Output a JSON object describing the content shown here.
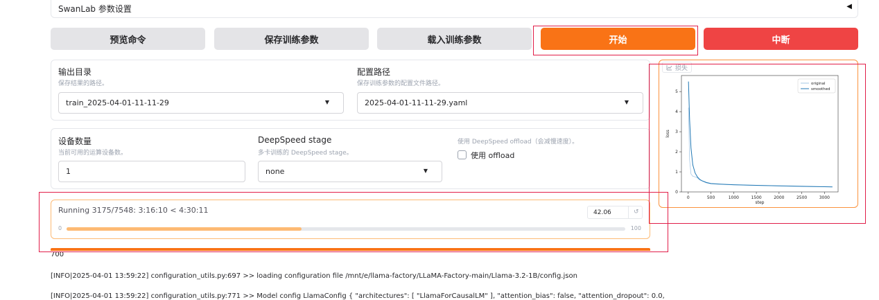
{
  "accordion": {
    "title": "SwanLab 参数设置",
    "toggle_glyph": "◀"
  },
  "buttons": {
    "preview": "预览命令",
    "save": "保存训练参数",
    "load": "载入训练参数",
    "start": "开始",
    "abort": "中断"
  },
  "output_dir": {
    "label": "输出目录",
    "info": "保存结果的路径。",
    "value": "train_2025-04-01-11-11-29"
  },
  "config_path": {
    "label": "配置路径",
    "info": "保存训练参数的配置文件路径。",
    "value": "2025-04-01-11-11-29.yaml"
  },
  "device_count": {
    "label": "设备数量",
    "info": "当前可用的运算设备数。",
    "value": "1"
  },
  "deepspeed_stage": {
    "label": "DeepSpeed stage",
    "info": "多卡训练的 DeepSpeed stage。",
    "value": "none"
  },
  "deepspeed_offload": {
    "info": "使用 DeepSpeed offload（会减慢速度）。",
    "checkbox_label": "使用 offload",
    "checked": false
  },
  "progress": {
    "title": "Running 3175/7548: 3:16:10 < 4:30:11",
    "value": "42.06",
    "min": "0",
    "max": "100",
    "fraction": 0.4206
  },
  "logs": [
    "700",
    "[INFO|2025-04-01 13:59:22] configuration_utils.py:697 >> loading configuration file /mnt/e/llama-factory/LLaMA-Factory-main/Llama-3.2-1B/config.json",
    "[INFO|2025-04-01 13:59:22] configuration_utils.py:771 >> Model config LlamaConfig { \"architectures\": [ \"LlamaForCausalLM\" ], \"attention_bias\": false, \"attention_dropout\": 0.0,"
  ],
  "plot": {
    "label": "损失",
    "icon": "chart-icon"
  },
  "chart_data": {
    "type": "line",
    "title": "",
    "xlabel": "step",
    "ylabel": "loss",
    "xlim": [
      -150,
      3300
    ],
    "ylim": [
      0,
      5.8
    ],
    "xticks": [
      0,
      500,
      1000,
      1500,
      2000,
      2500,
      3000
    ],
    "yticks": [
      0,
      1,
      2,
      3,
      4,
      5
    ],
    "legend_position": "top-right",
    "series": [
      {
        "name": "original",
        "color": "#a6c8e6",
        "x": [
          5,
          30,
          60,
          100,
          150,
          200,
          250,
          300,
          400,
          500,
          700,
          1000,
          1500,
          2000,
          2500,
          3000,
          3175
        ],
        "y": [
          4.2,
          1.6,
          0.9,
          0.78,
          0.75,
          0.7,
          0.6,
          0.55,
          0.45,
          0.4,
          0.38,
          0.35,
          0.32,
          0.3,
          0.27,
          0.26,
          0.25
        ]
      },
      {
        "name": "smoothed",
        "color": "#1f77b4",
        "x": [
          5,
          30,
          60,
          100,
          150,
          200,
          250,
          300,
          400,
          500,
          700,
          1000,
          1500,
          2000,
          2500,
          3000,
          3175
        ],
        "y": [
          5.5,
          3.6,
          2.2,
          1.35,
          0.95,
          0.75,
          0.63,
          0.56,
          0.47,
          0.42,
          0.39,
          0.36,
          0.33,
          0.3,
          0.28,
          0.26,
          0.25
        ]
      }
    ]
  }
}
